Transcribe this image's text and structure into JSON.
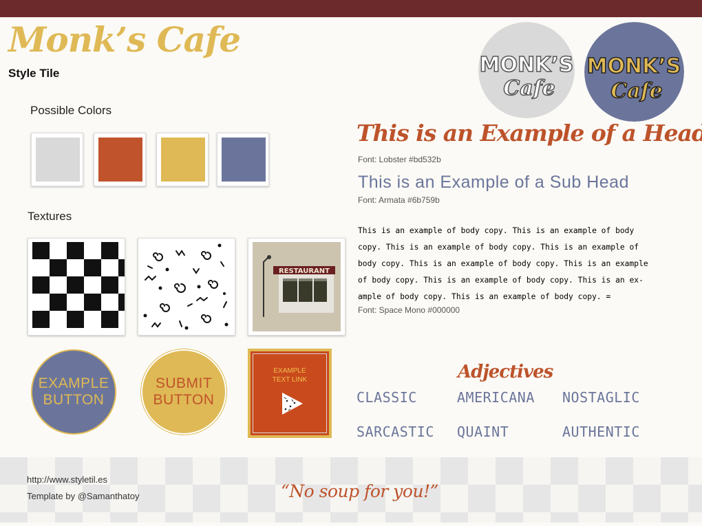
{
  "header": {
    "brand": "Monk’s Cafe",
    "subtitle": "Style Tile"
  },
  "colors": {
    "section_label": "Possible Colors",
    "swatches": [
      "#d9d9d9",
      "#c0532b",
      "#dfb955",
      "#6b759b"
    ]
  },
  "textures": {
    "section_label": "Textures",
    "items": [
      "checkerboard-texture",
      "squiggle-pattern-texture",
      "restaurant-sign-texture"
    ],
    "sign_text": "RESTAURANT"
  },
  "logos": {
    "line1": "MONK’S",
    "line2": "Cafe"
  },
  "typography": {
    "header_example": "This is an Example of a Header",
    "header_font": "Font: Lobster #bd532b",
    "subhead_example": "This is an Example of a Sub Head",
    "subhead_font": "Font: Armata #6b759b",
    "body_lines": [
      "This is an example of body copy. This is an example of body",
      "copy. This is an example of body copy. This is an example of",
      "body copy. This is an example of body copy. This is an example",
      "of body copy. This is an example of body copy. This is an ex-",
      "ample of body copy. This is an example of body copy. ="
    ],
    "body_font": "Font: Space Mono #000000"
  },
  "buttons": {
    "example": [
      "EXAMPLE",
      "BUTTON"
    ],
    "submit": [
      "SUBMIT",
      "BUTTON"
    ],
    "text_link": [
      "EXAMPLE",
      "TEXT LINK"
    ]
  },
  "adjectives": {
    "title": "Adjectives",
    "items": [
      "CLASSIC",
      "AMERICANA",
      "NOSTAGLIC",
      "SARCASTIC",
      "QUAINT",
      "AUTHENTIC"
    ]
  },
  "footer": {
    "url": "http://www.styletil.es",
    "credit": "Template by @Samanthatoy",
    "quote": "“No soup for you!”"
  },
  "palette": {
    "top_bar": "#6c2a2c",
    "brand_gold": "#dfb955",
    "accent_rust": "#bd532b",
    "accent_slate": "#6b759b"
  }
}
